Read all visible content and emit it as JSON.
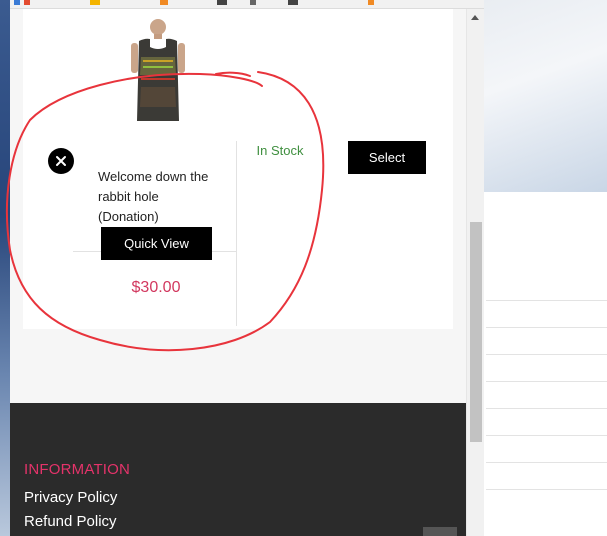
{
  "product": {
    "name": "Welcome down the rabbit hole (Donation)",
    "quick_view_label": "Quick View",
    "price": "$30.00",
    "stock_status": "In Stock",
    "select_label": "Select"
  },
  "footer": {
    "heading": "INFORMATION",
    "links": [
      "Privacy Policy",
      "Refund Policy"
    ]
  },
  "colors": {
    "price": "#d2385f",
    "stock": "#3f8f3f",
    "footer_heading": "#e4336a",
    "annotation": "#e8343c"
  },
  "icons": {
    "close": "close-icon",
    "scroll_up": "scroll-up-arrow-icon"
  }
}
